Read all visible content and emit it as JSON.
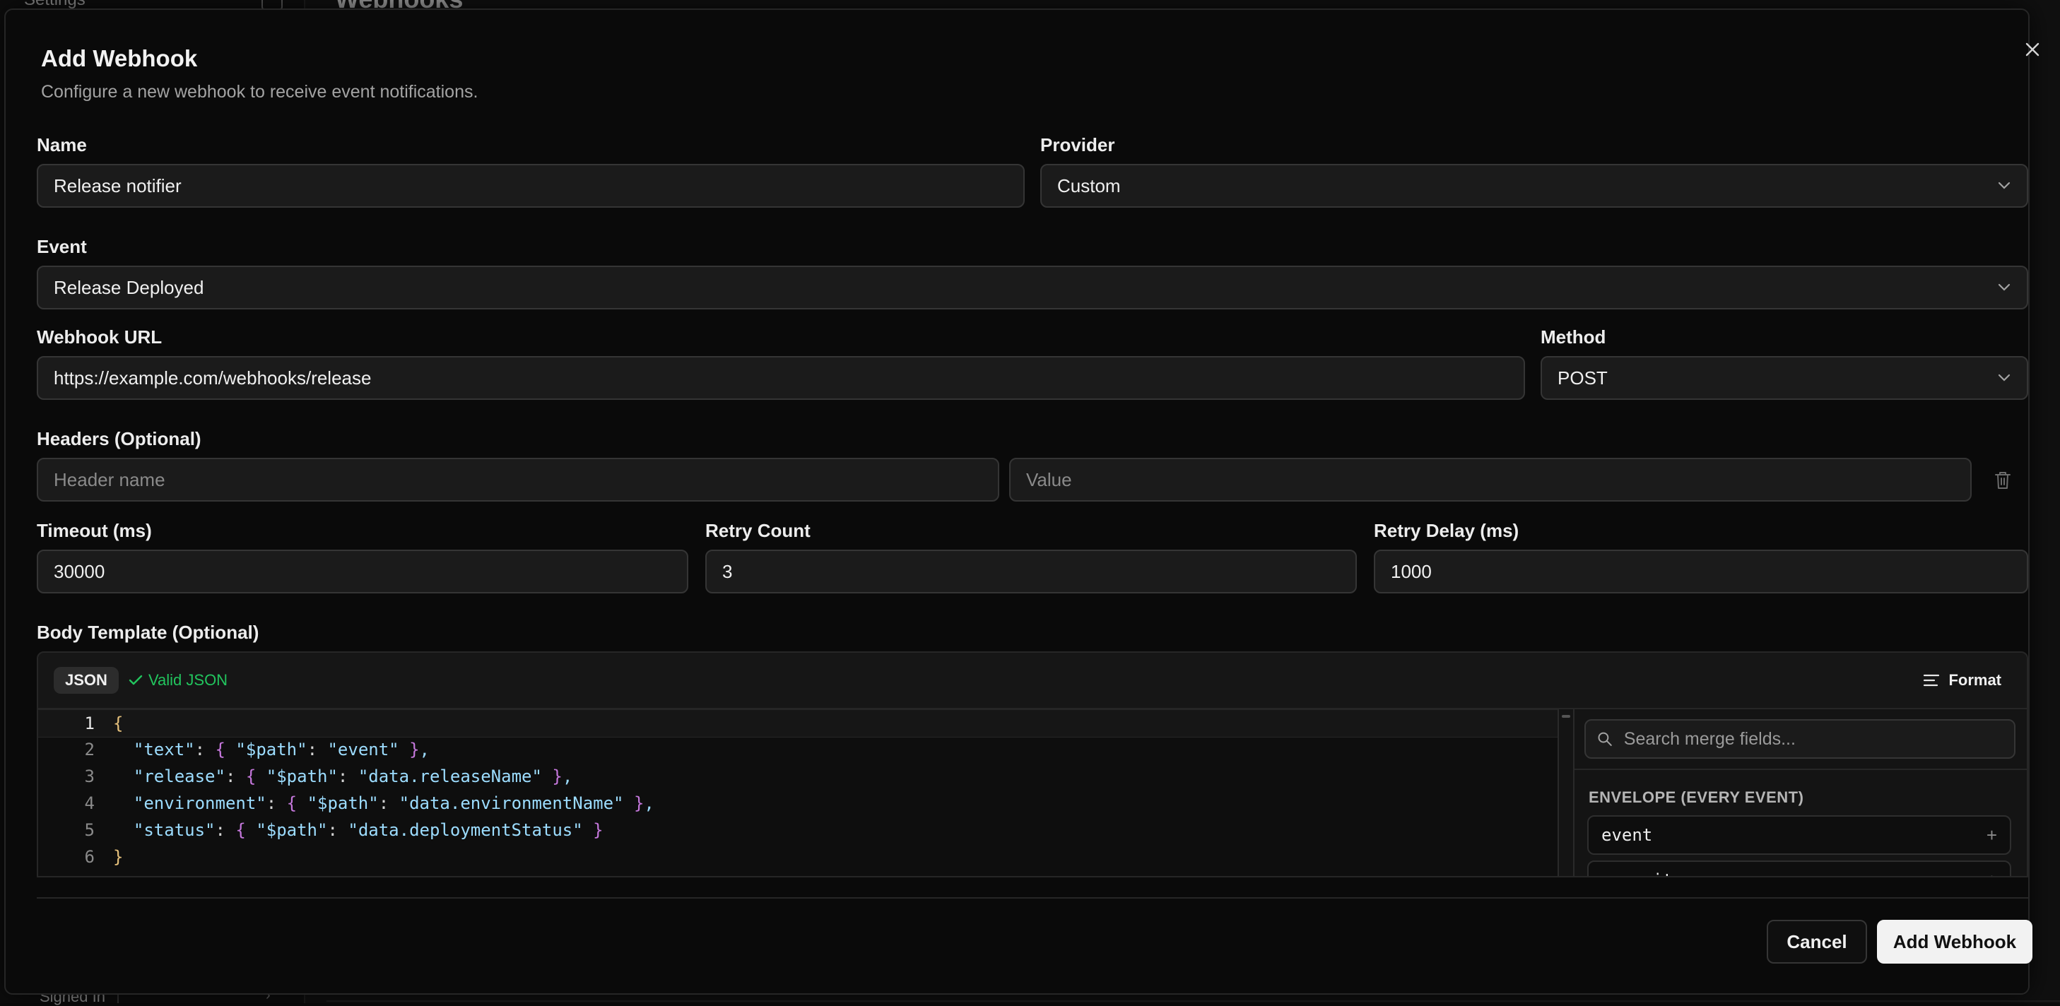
{
  "background": {
    "sidebar_settings": "Settings",
    "page_title": "Webhooks",
    "signed_in": "Signed In"
  },
  "modal": {
    "title": "Add Webhook",
    "subtitle": "Configure a new webhook to receive event notifications.",
    "close_icon": "close-icon"
  },
  "form": {
    "name_label": "Name",
    "name_value": "Release notifier",
    "provider_label": "Provider",
    "provider_value": "Custom",
    "event_label": "Event",
    "event_value": "Release Deployed",
    "url_label": "Webhook URL",
    "url_value": "https://example.com/webhooks/release",
    "method_label": "Method",
    "method_value": "POST",
    "headers_label": "Headers (Optional)",
    "header_name_placeholder": "Header name",
    "header_value_placeholder": "Value",
    "timeout_label": "Timeout (ms)",
    "timeout_value": "30000",
    "retry_count_label": "Retry Count",
    "retry_count_value": "3",
    "retry_delay_label": "Retry Delay (ms)",
    "retry_delay_value": "1000",
    "body_label": "Body Template (Optional)"
  },
  "editor": {
    "language_badge": "JSON",
    "valid_text": "Valid JSON",
    "format_label": "Format",
    "line_numbers": [
      "1",
      "2",
      "3",
      "4",
      "5",
      "6"
    ],
    "lines": [
      "{",
      "  \"text\": { \"$path\": \"event\" },",
      "  \"release\": { \"$path\": \"data.releaseName\" },",
      "  \"environment\": { \"$path\": \"data.environmentName\" },",
      "  \"status\": { \"$path\": \"data.deploymentStatus\" }",
      "}"
    ]
  },
  "merge_fields": {
    "search_placeholder": "Search merge fields...",
    "section_title": "ENVELOPE (EVERY EVENT)",
    "items": [
      "event",
      "repository"
    ]
  },
  "actions": {
    "cancel": "Cancel",
    "add": "Add Webhook"
  },
  "colors": {
    "accent_valid": "#22c55e",
    "primary_button": "#f2f2f2",
    "background": "#0a0a0a"
  }
}
